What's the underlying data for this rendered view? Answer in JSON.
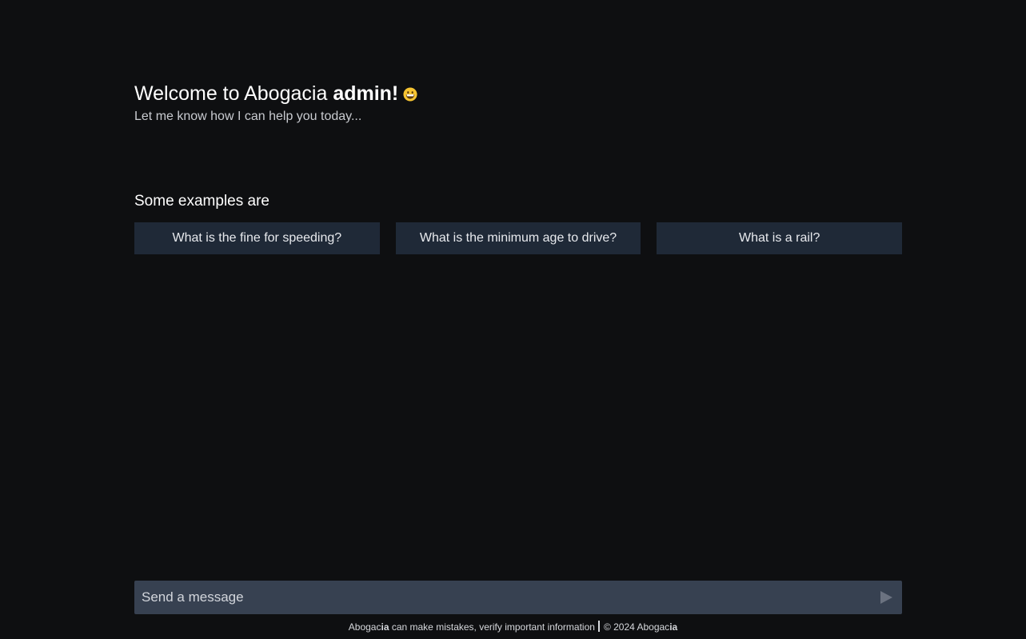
{
  "header": {
    "welcome_prefix": "Welcome to Abogacia",
    "username": "admin!",
    "emoji_icon": "grinning-face-emoji-icon",
    "subtitle": "Let me know how I can help you today..."
  },
  "examples": {
    "heading": "Some examples are",
    "items": [
      {
        "label": "What is the fine for speeding?"
      },
      {
        "label": "What is the minimum age to drive?"
      },
      {
        "label": "What is a rail?"
      }
    ]
  },
  "composer": {
    "placeholder": "Send a message",
    "value": "",
    "send_icon": "send-triangle-icon"
  },
  "footer": {
    "brand_a": "Abogac",
    "brand_b": "ia",
    "disclaimer": " can make mistakes, verify important information",
    "copyright": "© 2024 Abogac",
    "copyright_b": "ia"
  },
  "colors": {
    "background": "#0e0f11",
    "example_button": "#1f2937",
    "composer": "#374151",
    "emoji": "#f6c431"
  }
}
